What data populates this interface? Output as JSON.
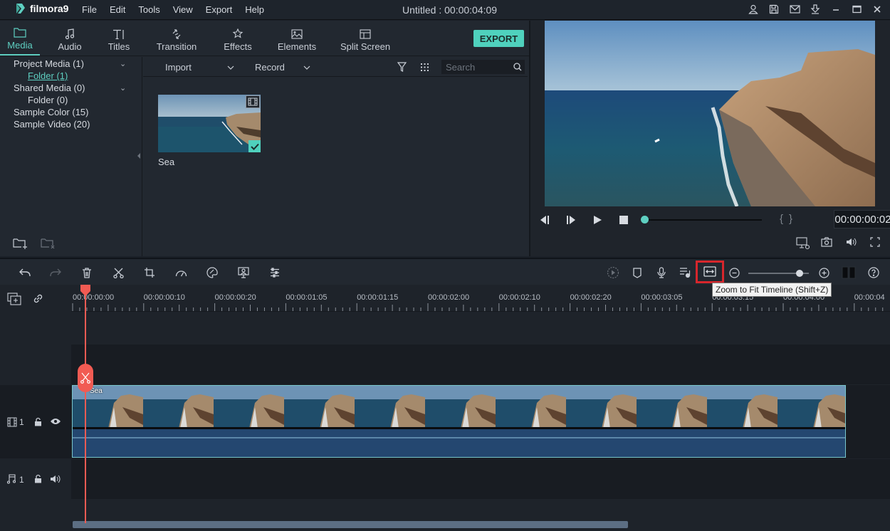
{
  "app": {
    "logo_text": "filmora9",
    "menu": [
      "File",
      "Edit",
      "Tools",
      "View",
      "Export",
      "Help"
    ],
    "window_title": "Untitled : 00:00:04:09",
    "window_icons": [
      "account-icon",
      "save-icon",
      "mail-icon",
      "download-icon",
      "minimize-icon",
      "maximize-icon",
      "close-icon"
    ]
  },
  "tabs": [
    {
      "label": "Media",
      "icon": "folder-icon",
      "active": true
    },
    {
      "label": "Audio",
      "icon": "music-note-icon"
    },
    {
      "label": "Titles",
      "icon": "text-icon"
    },
    {
      "label": "Transition",
      "icon": "transition-icon"
    },
    {
      "label": "Effects",
      "icon": "effects-icon"
    },
    {
      "label": "Elements",
      "icon": "image-icon"
    },
    {
      "label": "Split Screen",
      "icon": "split-screen-icon"
    }
  ],
  "export_label": "EXPORT",
  "tree": [
    {
      "label": "Project Media (1)",
      "expandable": true
    },
    {
      "label": "Folder (1)",
      "selected": true
    },
    {
      "label": "Shared Media (0)",
      "expandable": true
    },
    {
      "label": "Folder (0)"
    },
    {
      "label": "Sample Color (15)"
    },
    {
      "label": "Sample Video (20)"
    }
  ],
  "library": {
    "import_label": "Import",
    "record_label": "Record",
    "search_placeholder": "Search",
    "items": [
      {
        "name": "Sea",
        "checked": true
      }
    ]
  },
  "preview": {
    "timecode": "00:00:00:02",
    "progress": 0.0
  },
  "tooltip": "Zoom to Fit Timeline (Shift+Z)",
  "ruler": [
    "00:00:00:00",
    "00:00:00:10",
    "00:00:00:20",
    "00:00:01:05",
    "00:00:01:15",
    "00:00:02:00",
    "00:00:02:10",
    "00:00:02:20",
    "00:00:03:05",
    "00:00:03:15",
    "00:00:04:00",
    "00:00:04"
  ],
  "tracks": {
    "video": {
      "label": "1"
    },
    "audio": {
      "label": "1"
    },
    "clip_name": "Sea"
  },
  "zoom_slider": 0.85,
  "colors": {
    "accent": "#4fd1bd",
    "playhead": "#f15b53",
    "highlight": "#d7262c"
  }
}
